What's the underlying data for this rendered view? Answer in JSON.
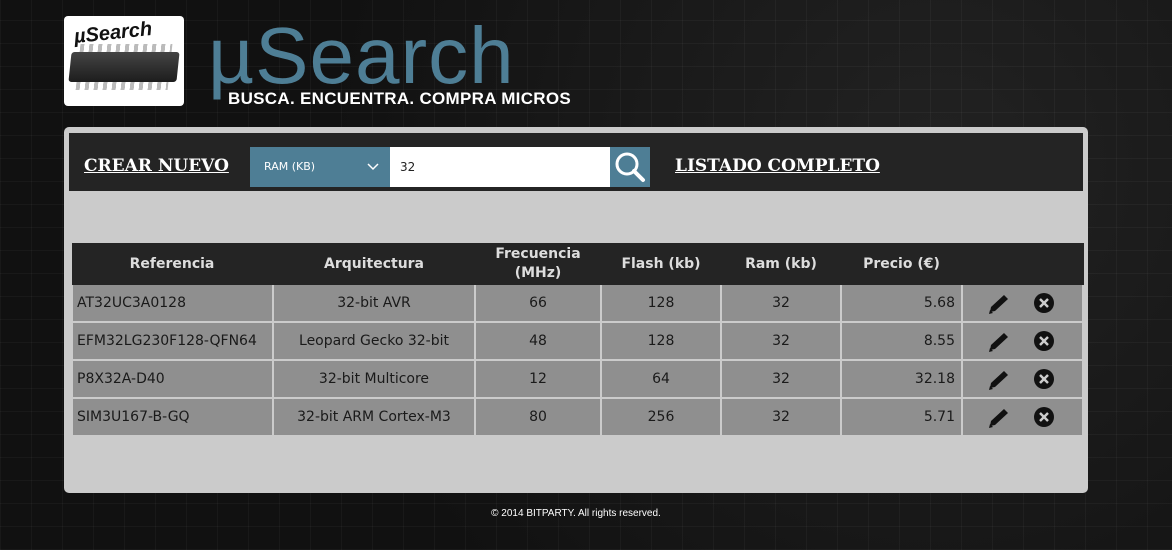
{
  "brand": {
    "logo_text": "µSearch",
    "title": "µSearch",
    "tagline": "BUSCA. ENCUENTRA. COMPRA MICROS"
  },
  "toolbar": {
    "create_label": "CREAR NUEVO",
    "list_label": "LISTADO COMPLETO",
    "search_field": "RAM (KB)",
    "search_value": "32",
    "search_icon": "magnifier-icon"
  },
  "table": {
    "headers": [
      "Referencia",
      "Arquitectura",
      "Frecuencia (MHz)",
      "Flash (kb)",
      "Ram (kb)",
      "Precio (€)"
    ],
    "rows": [
      {
        "ref": "AT32UC3A0128",
        "arch": "32-bit AVR",
        "freq": "66",
        "flash": "128",
        "ram": "32",
        "price": "5.68"
      },
      {
        "ref": "EFM32LG230F128-QFN64",
        "arch": "Leopard Gecko 32-bit",
        "freq": "48",
        "flash": "128",
        "ram": "32",
        "price": "8.55"
      },
      {
        "ref": "P8X32A-D40",
        "arch": "32-bit Multicore",
        "freq": "12",
        "flash": "64",
        "ram": "32",
        "price": "32.18"
      },
      {
        "ref": "SIM3U167-B-GQ",
        "arch": "32-bit ARM Cortex-M3",
        "freq": "80",
        "flash": "256",
        "ram": "32",
        "price": "5.71"
      }
    ],
    "row_icons": [
      "pencil-edit-icon",
      "circle-x-delete-icon"
    ]
  },
  "footer": {
    "text": "© 2014 BITPARTY. All rights reserved."
  },
  "colors": {
    "accent": "#4e7e95",
    "panel": "#cbcbcb",
    "toolbar": "#242424",
    "row": "#8f8f8f"
  }
}
